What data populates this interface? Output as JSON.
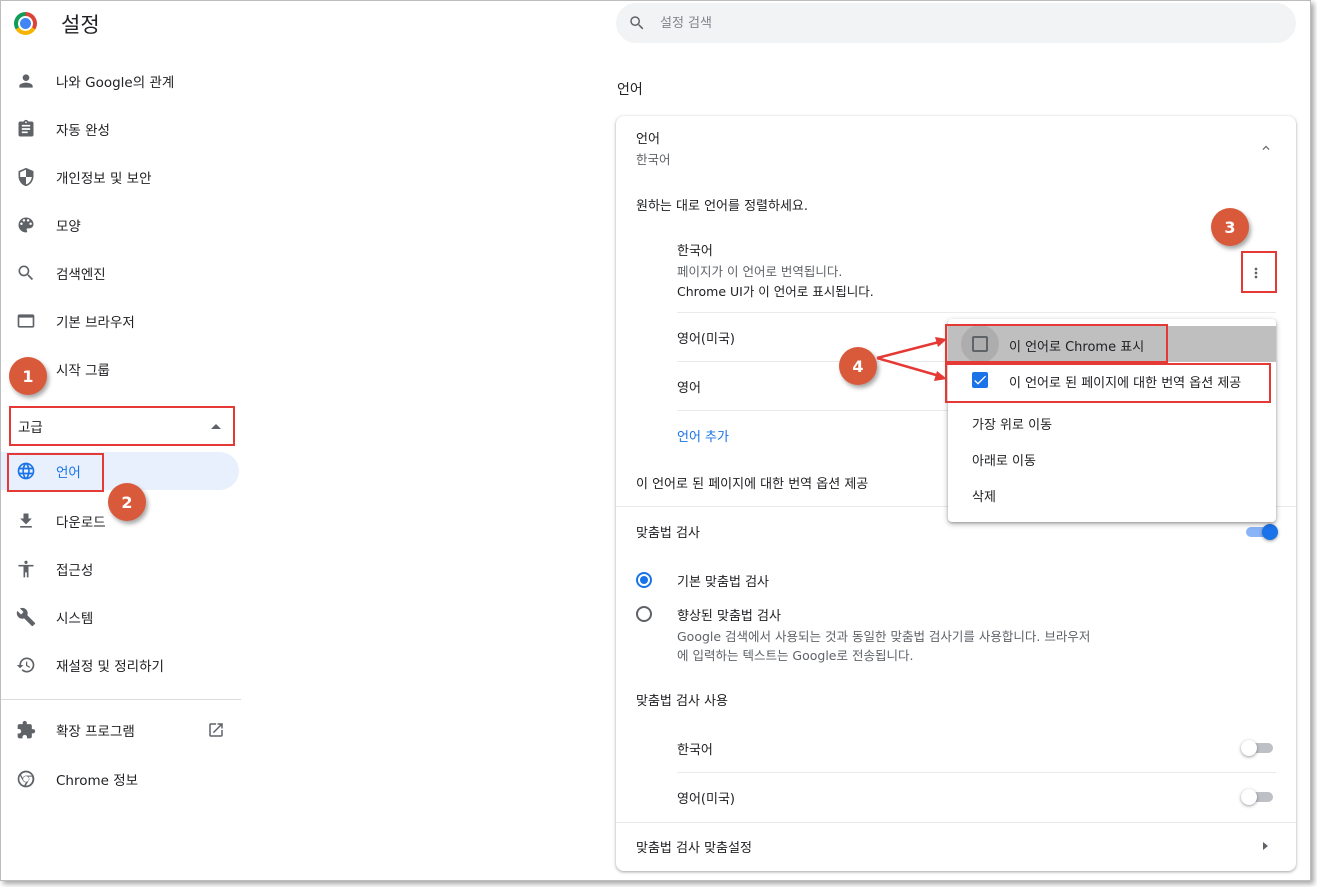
{
  "app": {
    "title": "설정"
  },
  "search": {
    "placeholder": "설정 검색"
  },
  "sidebar": {
    "items": [
      {
        "label": "나와 Google의 관계",
        "icon": "person-icon"
      },
      {
        "label": "자동 완성",
        "icon": "clipboard-icon"
      },
      {
        "label": "개인정보 및 보안",
        "icon": "shield-icon"
      },
      {
        "label": "모양",
        "icon": "palette-icon"
      },
      {
        "label": "검색엔진",
        "icon": "search-icon"
      },
      {
        "label": "기본 브라우저",
        "icon": "browser-icon"
      },
      {
        "label": "시작 그룹",
        "icon": "power-icon"
      }
    ],
    "advanced_label": "고급",
    "advanced_items": [
      {
        "label": "언어",
        "icon": "globe-icon",
        "active": true
      },
      {
        "label": "다운로드",
        "icon": "download-icon"
      },
      {
        "label": "접근성",
        "icon": "accessibility-icon"
      },
      {
        "label": "시스템",
        "icon": "wrench-icon"
      },
      {
        "label": "재설정 및 정리하기",
        "icon": "restore-icon"
      }
    ],
    "footer_items": [
      {
        "label": "확장 프로그램",
        "icon": "puzzle-icon",
        "external_icon": "open-in-new-icon"
      },
      {
        "label": "Chrome 정보",
        "icon": "chrome-icon"
      }
    ]
  },
  "main": {
    "section_title": "언어",
    "language_panel": {
      "title": "언어",
      "current": "한국어",
      "instruction": "원하는 대로 언어를 정렬하세요.",
      "languages": [
        {
          "name": "한국어",
          "notes": [
            "페이지가 이 언어로 번역됩니다.",
            "Chrome UI가 이 언어로 표시됩니다."
          ]
        },
        {
          "name": "영어(미국)"
        },
        {
          "name": "영어"
        }
      ],
      "add_language": "언어 추가",
      "offer_translate": "이 언어로 된 페이지에 대한 번역 옵션 제공"
    },
    "spellcheck": {
      "title": "맞춤법 검사",
      "enabled": true,
      "options": [
        {
          "label": "기본 맞춤법 검사",
          "checked": true
        },
        {
          "label": "향상된 맞춤법 검사",
          "checked": false,
          "description": [
            "Google 검색에서 사용되는 것과 동일한 맞춤법 검사기를 사용합니다. 브라우저",
            "에 입력하는 텍스트는 Google로 전송됩니다."
          ]
        }
      ],
      "use_title": "맞춤법 검사 사용",
      "use_languages": [
        {
          "name": "한국어",
          "enabled": false
        },
        {
          "name": "영어(미국)",
          "enabled": false
        }
      ],
      "customize_label": "맞춤법 검사 맞춤설정"
    }
  },
  "context_menu": {
    "items": [
      {
        "label": "이 언어로 Chrome 표시",
        "checkbox": "unchecked"
      },
      {
        "label": "이 언어로 된 페이지에 대한 번역 옵션 제공",
        "checkbox": "checked"
      },
      {
        "label": "가장 위로 이동"
      },
      {
        "label": "아래로 이동"
      },
      {
        "label": "삭제"
      }
    ]
  },
  "annotations": {
    "steps": [
      "1",
      "2",
      "3",
      "4"
    ],
    "highlight_color": "#e53935",
    "badge_color": "#d9593b"
  },
  "colors": {
    "accent": "#1a73e8",
    "active_bg": "#e8f0fe"
  }
}
